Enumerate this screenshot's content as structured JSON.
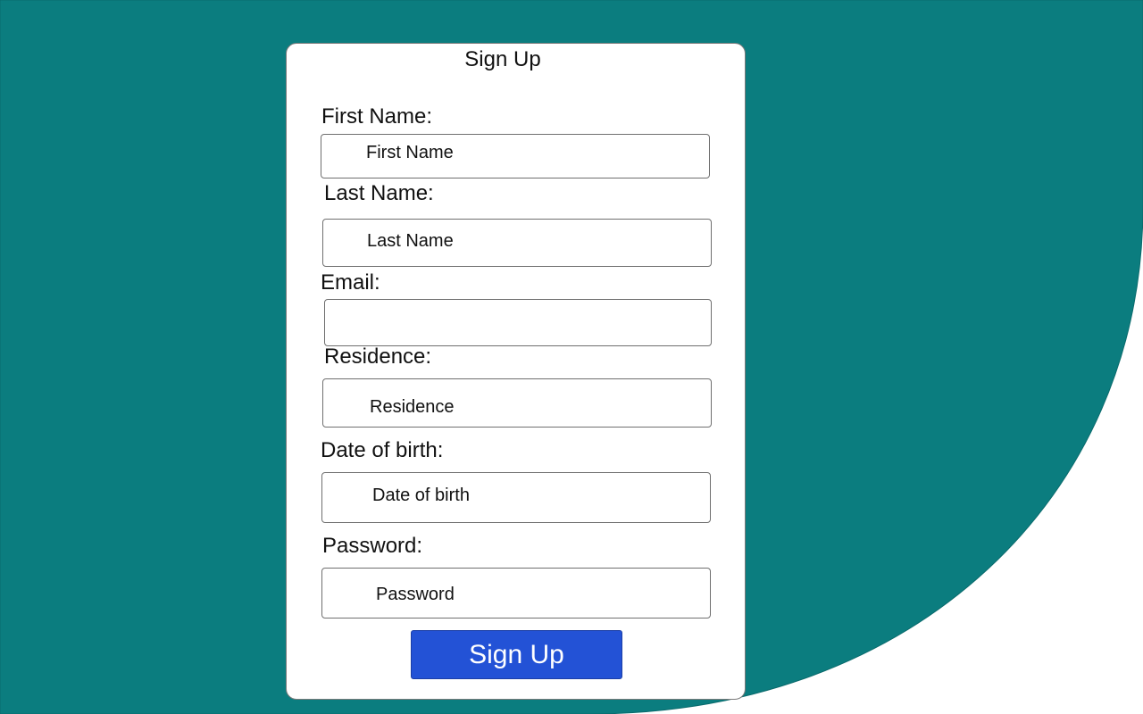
{
  "colors": {
    "background_teal": "#0b7d7f",
    "card_background": "#ffffff",
    "button_blue": "#2352d6",
    "button_text": "#ffffff"
  },
  "form": {
    "title": "Sign Up",
    "fields": [
      {
        "label": "First Name:",
        "placeholder": "First Name",
        "value": ""
      },
      {
        "label": "Last Name:",
        "placeholder": "Last Name",
        "value": ""
      },
      {
        "label": "Email:",
        "placeholder": "",
        "value": ""
      },
      {
        "label": "Residence:",
        "placeholder": "Residence",
        "value": ""
      },
      {
        "label": "Date of birth:",
        "placeholder": "Date of birth",
        "value": ""
      },
      {
        "label": "Password:",
        "placeholder": "Password",
        "value": ""
      }
    ],
    "submit_label": "Sign Up"
  }
}
